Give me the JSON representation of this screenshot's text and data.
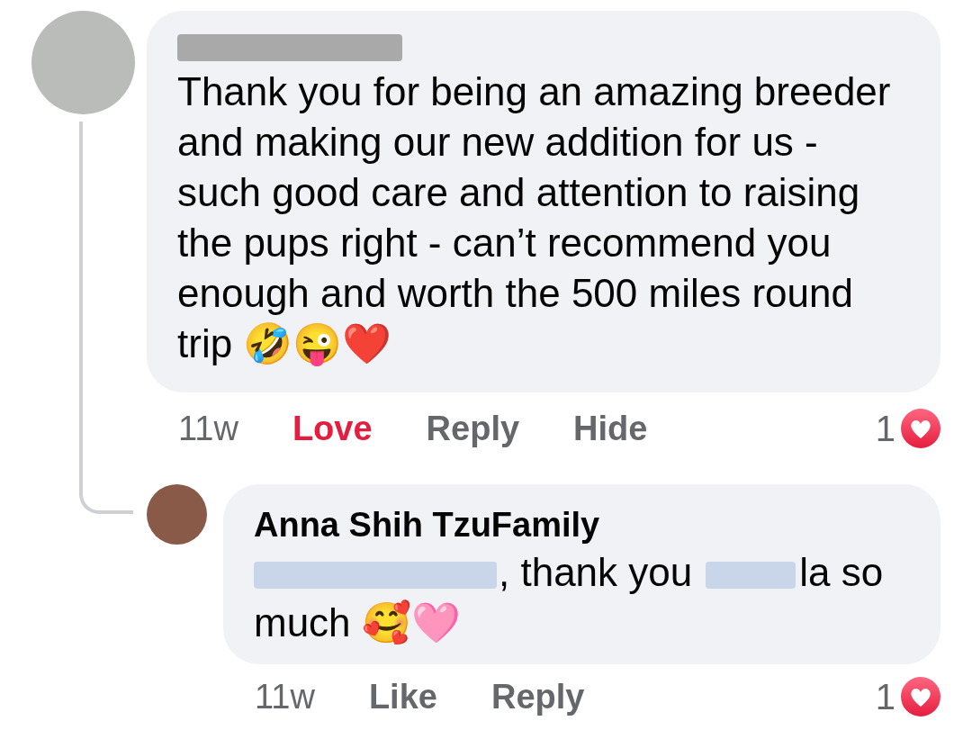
{
  "comment": {
    "author_redacted": true,
    "body": "Thank you for being an amazing breeder and making our new addition for us - such good care and attention to raising the pups right - can’t recommend you enough and worth the 500 miles round trip 🤣😜❤️",
    "time": "11w",
    "reaction_button": {
      "label": "Love",
      "selected": true
    },
    "links": [
      "Reply",
      "Hide"
    ],
    "reaction_count": "1"
  },
  "reply": {
    "author": "Anna Shih TzuFamily",
    "body": [
      {
        "kind": "redacted"
      },
      {
        "kind": "text",
        "text": ", thank you"
      },
      {
        "kind": "redacted"
      },
      {
        "kind": "text",
        "text": "la so"
      },
      {
        "kind": "text",
        "text": "much 🥰🩷"
      }
    ],
    "time": "11w",
    "reaction_button": {
      "label": "Like",
      "selected": false
    },
    "links": [
      "Reply"
    ],
    "reaction_count": "1"
  }
}
